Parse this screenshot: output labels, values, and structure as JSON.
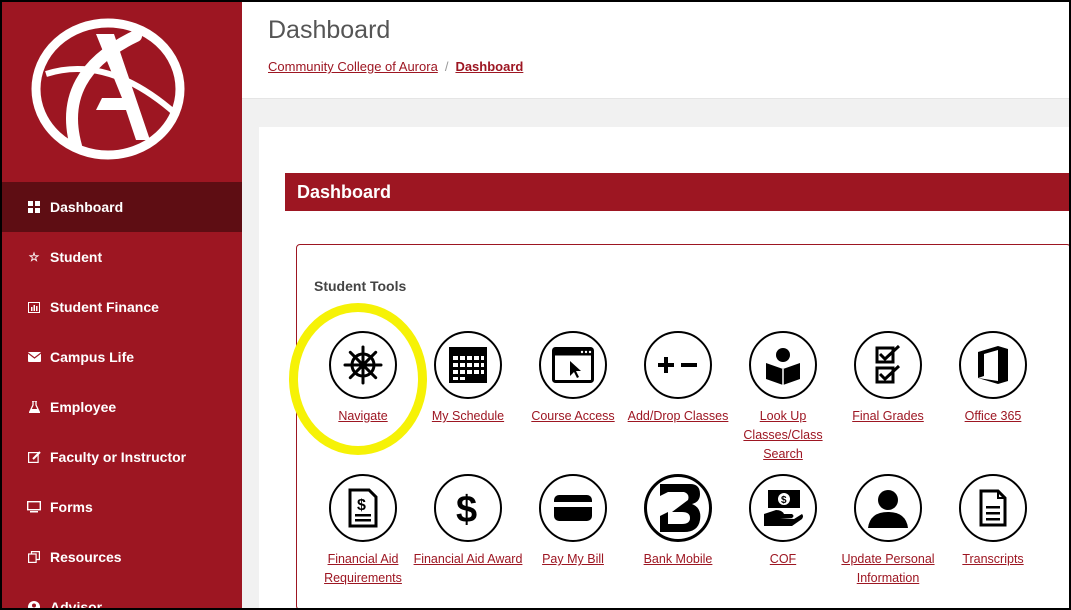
{
  "sidebar": {
    "logo_alt": "CCA",
    "items": [
      {
        "label": "Dashboard",
        "icon": "grid-icon"
      },
      {
        "label": "Student",
        "icon": "star-icon"
      },
      {
        "label": "Student Finance",
        "icon": "bar-chart-icon"
      },
      {
        "label": "Campus Life",
        "icon": "envelope-icon"
      },
      {
        "label": "Employee",
        "icon": "flask-icon"
      },
      {
        "label": "Faculty or Instructor",
        "icon": "edit-icon"
      },
      {
        "label": "Forms",
        "icon": "monitor-icon"
      },
      {
        "label": "Resources",
        "icon": "copy-icon"
      },
      {
        "label": "Advisor",
        "icon": "user-circle-icon"
      }
    ]
  },
  "header": {
    "title": "Dashboard",
    "breadcrumb": {
      "root": "Community College of Aurora",
      "separator": "/",
      "current": "Dashboard"
    }
  },
  "main": {
    "section_title": "Dashboard",
    "tools_title": "Student Tools",
    "tools_row1": [
      {
        "label": "Navigate",
        "icon": "helm-icon"
      },
      {
        "label": "My Schedule",
        "icon": "calendar-icon"
      },
      {
        "label": "Course Access",
        "icon": "browser-cursor-icon"
      },
      {
        "label": "Add/Drop Classes",
        "icon": "plus-minus-icon"
      },
      {
        "label": "Look Up Classes/Class Search",
        "icon": "reader-icon"
      },
      {
        "label": "Final Grades",
        "icon": "checklist-icon"
      },
      {
        "label": "Office 365",
        "icon": "office-icon"
      }
    ],
    "tools_row2": [
      {
        "label": "Financial Aid Requirements",
        "icon": "money-document-icon"
      },
      {
        "label": "Financial Aid Award",
        "icon": "dollar-icon"
      },
      {
        "label": "Pay My Bill",
        "icon": "credit-card-icon"
      },
      {
        "label": "Bank Mobile",
        "icon": "bank-mobile-icon"
      },
      {
        "label": "COF",
        "icon": "cash-hand-icon"
      },
      {
        "label": "Update Personal Information",
        "icon": "person-icon"
      },
      {
        "label": "Transcripts",
        "icon": "document-icon"
      }
    ]
  },
  "colors": {
    "brand": "#9d1622",
    "brand_dark": "#5e0d13",
    "highlight": "#f6f206"
  }
}
